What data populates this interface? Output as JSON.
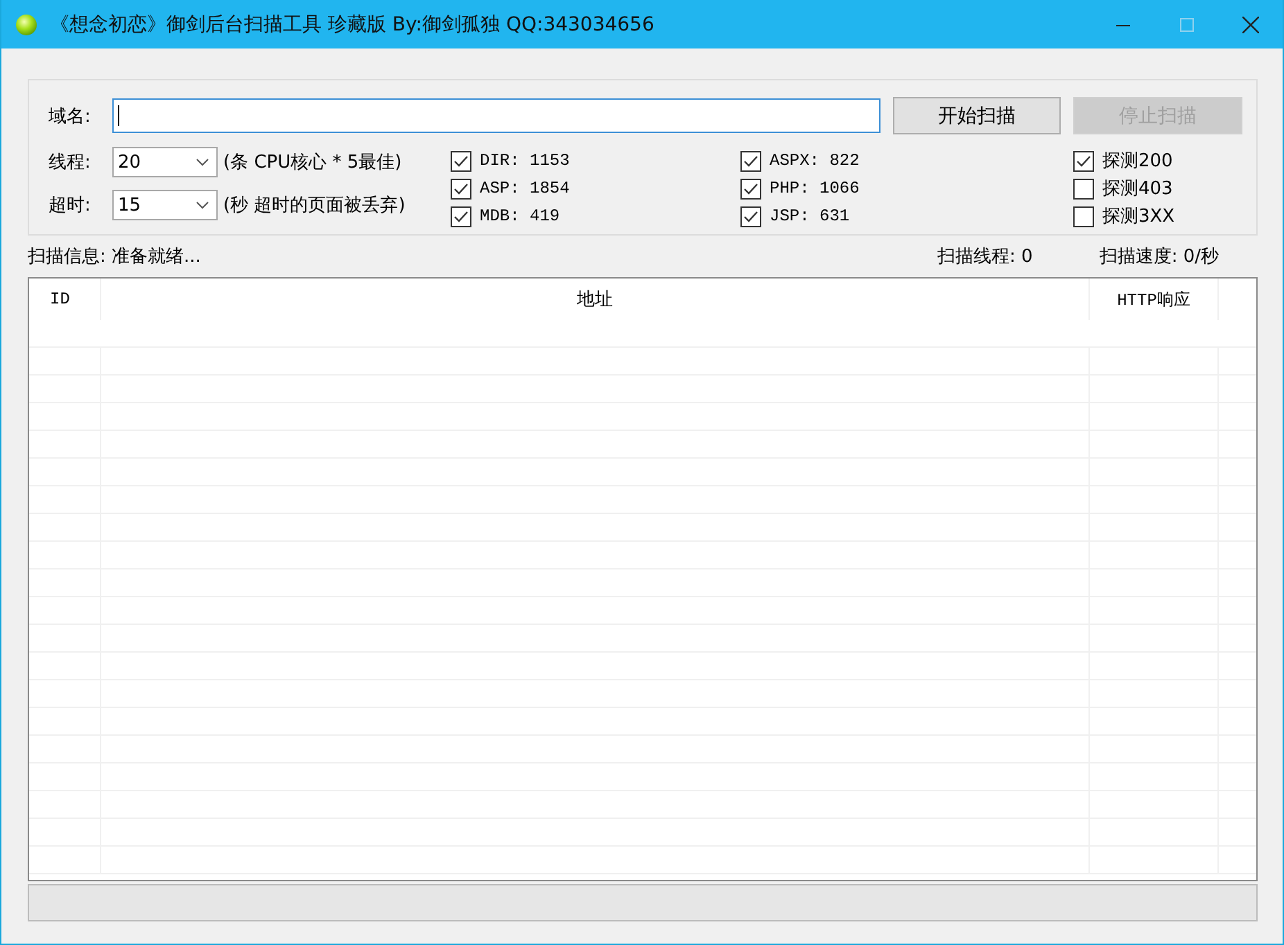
{
  "window": {
    "title": "《想念初恋》御剑后台扫描工具 珍藏版 By:御剑孤独 QQ:343034656"
  },
  "domain": {
    "label": "域名:"
  },
  "buttons": [
    {
      "label": "开始扫描",
      "disabled": false
    },
    {
      "label": "停止扫描",
      "disabled": true
    }
  ],
  "options": [
    {
      "label": "线程:",
      "value": "20",
      "hint": "(条 CPU核心 * 5最佳)"
    },
    {
      "label": "超时:",
      "value": "15",
      "hint": "(秒 超时的页面被丢弃)"
    }
  ],
  "dict_columns": [
    [
      {
        "label": "DIR: 1153",
        "checked": true
      },
      {
        "label": "ASP: 1854",
        "checked": true
      },
      {
        "label": "MDB: 419",
        "checked": true
      }
    ],
    [
      {
        "label": "ASPX: 822",
        "checked": true
      },
      {
        "label": "PHP: 1066",
        "checked": true
      },
      {
        "label": "JSP: 631",
        "checked": true
      }
    ],
    [
      {
        "label": "探测200",
        "checked": true
      },
      {
        "label": "探测403",
        "checked": false
      },
      {
        "label": "探测3XX",
        "checked": false
      }
    ]
  ],
  "status": {
    "info": "扫描信息: 准备就绪...",
    "threads": "扫描线程: 0",
    "speed": "扫描速度: 0/秒"
  },
  "table": {
    "columns": [
      "ID",
      "地址",
      "HTTP响应"
    ]
  },
  "progress": {
    "level": 0
  }
}
